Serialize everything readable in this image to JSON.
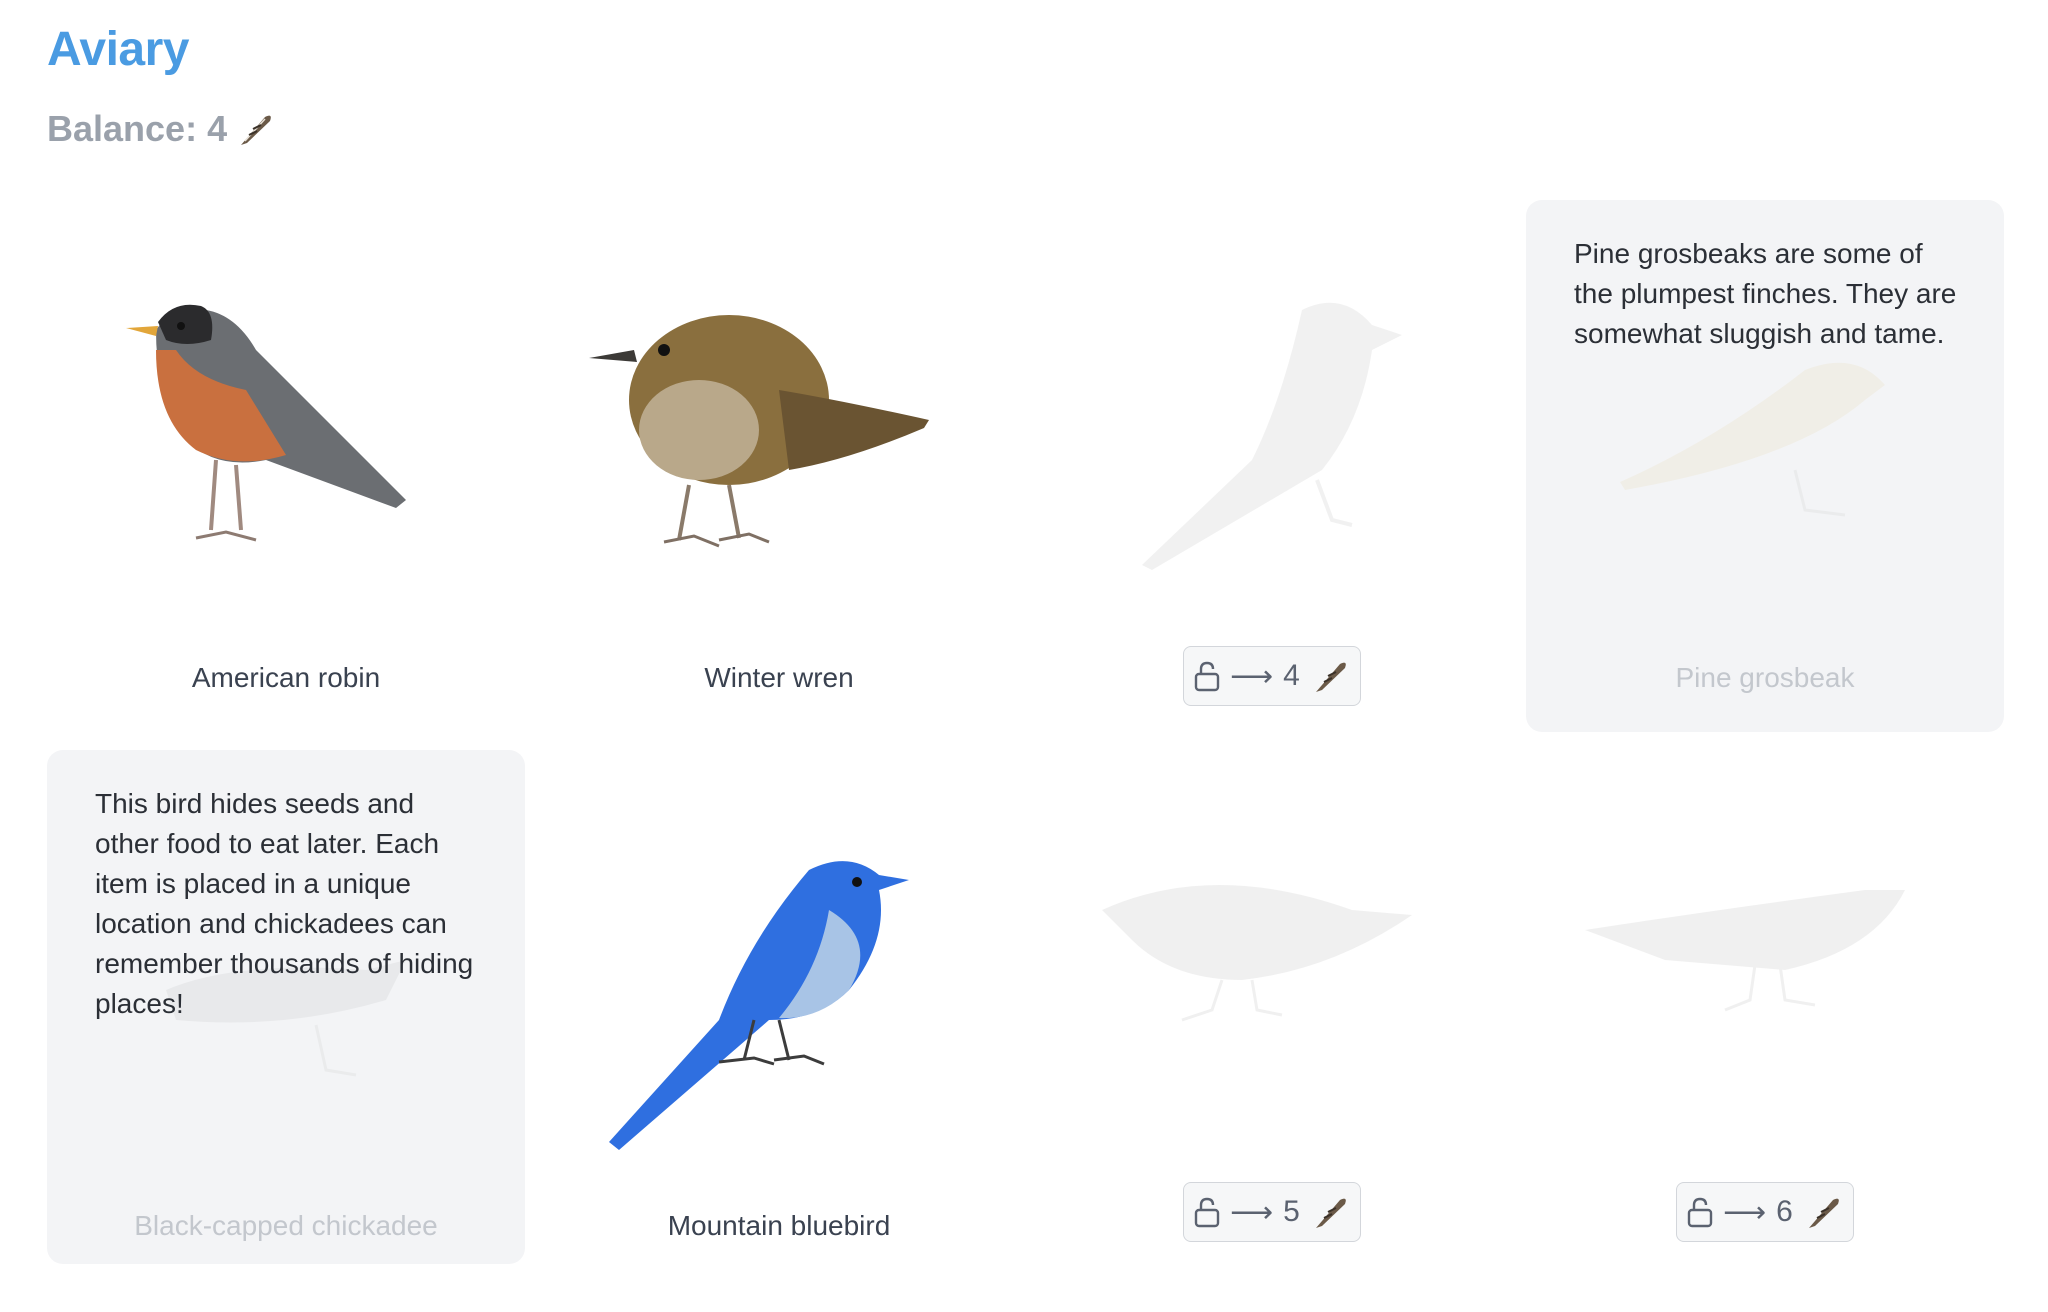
{
  "app": {
    "title": "Aviary"
  },
  "balance": {
    "label": "Balance: 4",
    "icon": "feather-icon"
  },
  "birds": [
    {
      "name": "American robin",
      "state": "unlocked"
    },
    {
      "name": "Winter wren",
      "state": "unlocked"
    },
    {
      "state": "locked",
      "cost": "4"
    },
    {
      "name": "Pine grosbeak",
      "state": "flipped",
      "fact": "Pine grosbeaks are some of the plumpest finches. They are somewhat sluggish and tame."
    },
    {
      "name": "Black-capped chickadee",
      "state": "flipped",
      "fact": "This bird hides seeds and other food to eat later. Each item is placed in a unique location and chickadees can remember thousands of hiding places!"
    },
    {
      "name": "Mountain bluebird",
      "state": "unlocked"
    },
    {
      "state": "locked",
      "cost": "5"
    },
    {
      "state": "locked",
      "cost": "6"
    }
  ],
  "colors": {
    "title": "#4a9be2",
    "balance": "#9aa1ab",
    "card_flipped_bg": "#f3f4f6",
    "robin_breast": "#c9703f",
    "bluebird": "#2f6fe0"
  },
  "icons": {
    "lock": "lock-icon",
    "arrow": "arrow-right-icon",
    "feather": "feather-icon"
  }
}
